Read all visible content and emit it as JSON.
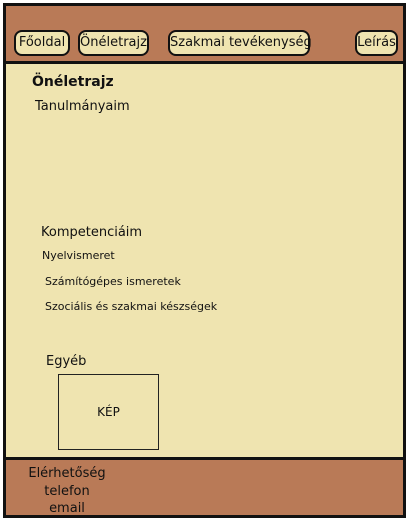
{
  "nav": {
    "items": [
      {
        "label": "Főoldal"
      },
      {
        "label": "Önéletrajz"
      },
      {
        "label": "Szakmai tevékenység"
      },
      {
        "label": "Leírás"
      }
    ]
  },
  "main": {
    "title": "Önéletrajz",
    "studies_heading": "Tanulmányaim",
    "competencies_heading": "Kompetenciáim",
    "competencies": [
      "Nyelvismeret",
      "Számítógépes ismeretek",
      "Szociális és szakmai készségek"
    ],
    "other_heading": "Egyéb",
    "image_placeholder": "KÉP"
  },
  "footer": {
    "contact_heading": "Elérhetőség",
    "phone_label": "telefon",
    "email_label": "email"
  },
  "colors": {
    "header_footer": "#b97a57",
    "content_bg": "#efe4b0",
    "border": "#111111"
  }
}
